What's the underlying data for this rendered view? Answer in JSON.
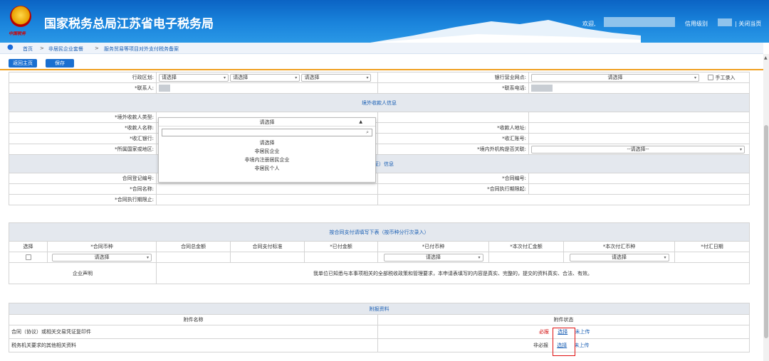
{
  "header": {
    "site_title": "国家税务总局江苏省电子税务局",
    "welcome": "欢迎,",
    "credit_label": "信用级别",
    "close_label": "| 关闭当页",
    "emblem_text": "中国税务"
  },
  "breadcrumb": {
    "home": "首页",
    "sep": ">",
    "level1": "非居民企业套餐",
    "level2": "服务贸易等项目对外支付税务备案"
  },
  "toolbar": {
    "back": "返回主页",
    "save": "保存"
  },
  "common": {
    "please_select": "请选择",
    "placeholder_select": "--请选择--"
  },
  "section1": {
    "region_label": "行政区划:",
    "bank_label": "银行营业网点:",
    "manual_label": "手工录入",
    "contact_label": "*联系人:",
    "phone_label": "*联系电话:"
  },
  "section2": {
    "title": "境外收款人信息",
    "payee_type": "*境外收款人类型:",
    "payee_name": "*收款人名称:",
    "payee_addr": "*收款人地址:",
    "remit_bank": "*收汇银行:",
    "remit_acct": "*收汇账号:",
    "country": "*所属国家或地区:",
    "related": "*境内外机构是否关联:"
  },
  "dropdown": {
    "options": [
      "请选择",
      "非居民企业",
      "非境内注册居民企业",
      "非居民个人"
    ]
  },
  "section3": {
    "title_tail": "付凭证）信息",
    "reg_no": "合同登记编号:",
    "contract_no": "*合同编号:",
    "contract_name": "*合同名称:",
    "exec_start": "*合同执行期限起:",
    "exec_end": "*合同执行期限止:"
  },
  "section4": {
    "title": "按合同支付请填写下表（按币种分行次录入）",
    "cols": [
      "选择",
      "*合同币种",
      "合同总金额",
      "合同支付标准",
      "*已付金额",
      "*已付币种",
      "*本次付汇金额",
      "*本次付汇币种",
      "*付汇日期"
    ]
  },
  "declaration": {
    "label": "企业声明",
    "text": "我单位已知悉与本事项相关的全部税收政策和管理要求，本申请表填写的内容是真实、完整的，提交的资料真实、合法、有效。"
  },
  "attachments": {
    "title": "附报资料",
    "col_name": "附件名称",
    "col_status": "附件状态",
    "rows": [
      {
        "name": "合同（协议）或相关交易凭证复印件",
        "req": "必报",
        "action": "选择",
        "state": "未上传"
      },
      {
        "name": "税务机关要求的其他相关资料",
        "req": "非必报",
        "action": "选择",
        "state": "未上传"
      }
    ]
  }
}
